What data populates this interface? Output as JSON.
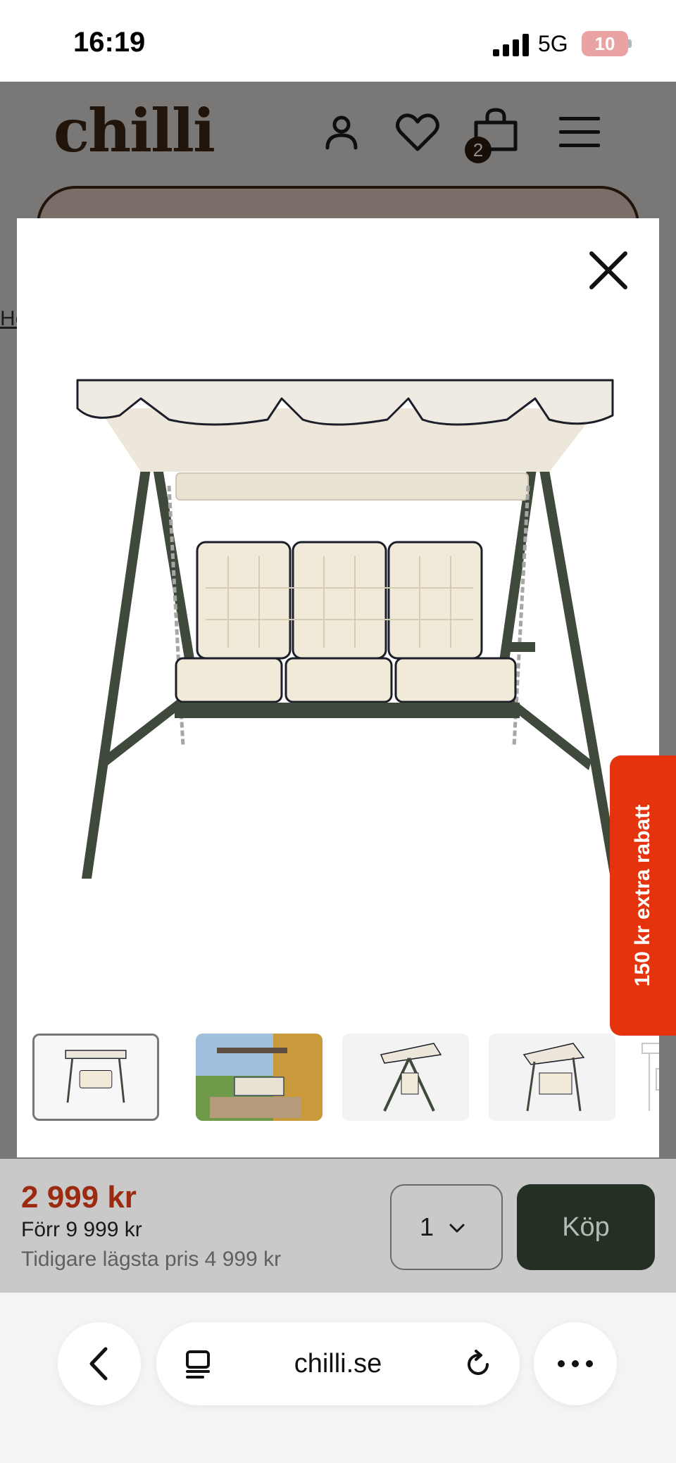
{
  "status_bar": {
    "time": "16:19",
    "network": "5G",
    "battery": "10",
    "icons": [
      "signal-icon",
      "battery-icon"
    ]
  },
  "header": {
    "logo": "chilli",
    "cart_count": "2",
    "icons": [
      "user-icon",
      "heart-icon",
      "cart-icon",
      "menu-icon"
    ],
    "logo_color": "#3d2614"
  },
  "background_page": {
    "breadcrumb_fragment": "He"
  },
  "modal": {
    "close_icon": "close-icon",
    "main_image": "garden-swing-three-seater-with-canopy",
    "thumbnails": [
      {
        "label": "swing-front-view",
        "selected": true
      },
      {
        "label": "swing-in-garden",
        "selected": false
      },
      {
        "label": "swing-side-view",
        "selected": false
      },
      {
        "label": "swing-angled-view",
        "selected": false
      },
      {
        "label": "swing-sketch",
        "selected": false
      }
    ]
  },
  "side_tab": {
    "label": "150 kr extra rabatt",
    "color": "#e5330d"
  },
  "price_bar": {
    "price_now": "2 999 kr",
    "price_before": "Förr 9 999 kr",
    "lowest_price": "Tidigare lägsta pris 4 999 kr",
    "quantity": "1",
    "buy_label": "Köp",
    "price_color": "#9c2a10",
    "buy_color": "#243024"
  },
  "browser": {
    "url": "chilli.se",
    "icons": [
      "back-icon",
      "tabs-icon",
      "reload-icon",
      "more-icon"
    ]
  }
}
